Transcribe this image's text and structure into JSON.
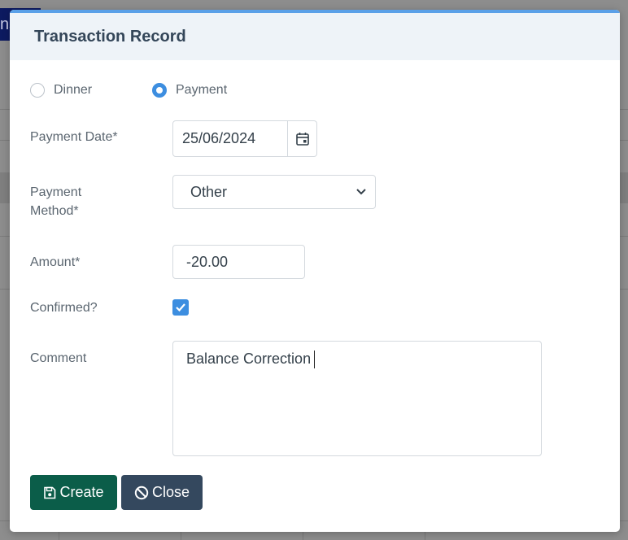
{
  "background": {
    "tab_text": "ns"
  },
  "modal": {
    "title": "Transaction Record",
    "type_options": [
      {
        "label": "Dinner",
        "selected": false
      },
      {
        "label": "Payment",
        "selected": true
      }
    ],
    "payment_date": {
      "label": "Payment Date*",
      "value": "25/06/2024",
      "icon": "calendar-icon"
    },
    "payment_method": {
      "label_line1": "Payment",
      "label_line2": "Method*",
      "value": "Other",
      "icon": "chevron-down-icon"
    },
    "amount": {
      "label": "Amount*",
      "value": "-20.00"
    },
    "confirmed": {
      "label": "Confirmed?",
      "checked": true
    },
    "comment": {
      "label": "Comment",
      "value": "Balance Correction"
    },
    "buttons": {
      "create": {
        "label": "Create",
        "icon": "floppy-disk-icon"
      },
      "close": {
        "label": "Close",
        "icon": "ban-icon"
      }
    }
  },
  "colors": {
    "accent": "#3d8ee0",
    "create_button": "#0b5d49",
    "close_button": "#34485e",
    "header_bg": "#eef3f8"
  }
}
